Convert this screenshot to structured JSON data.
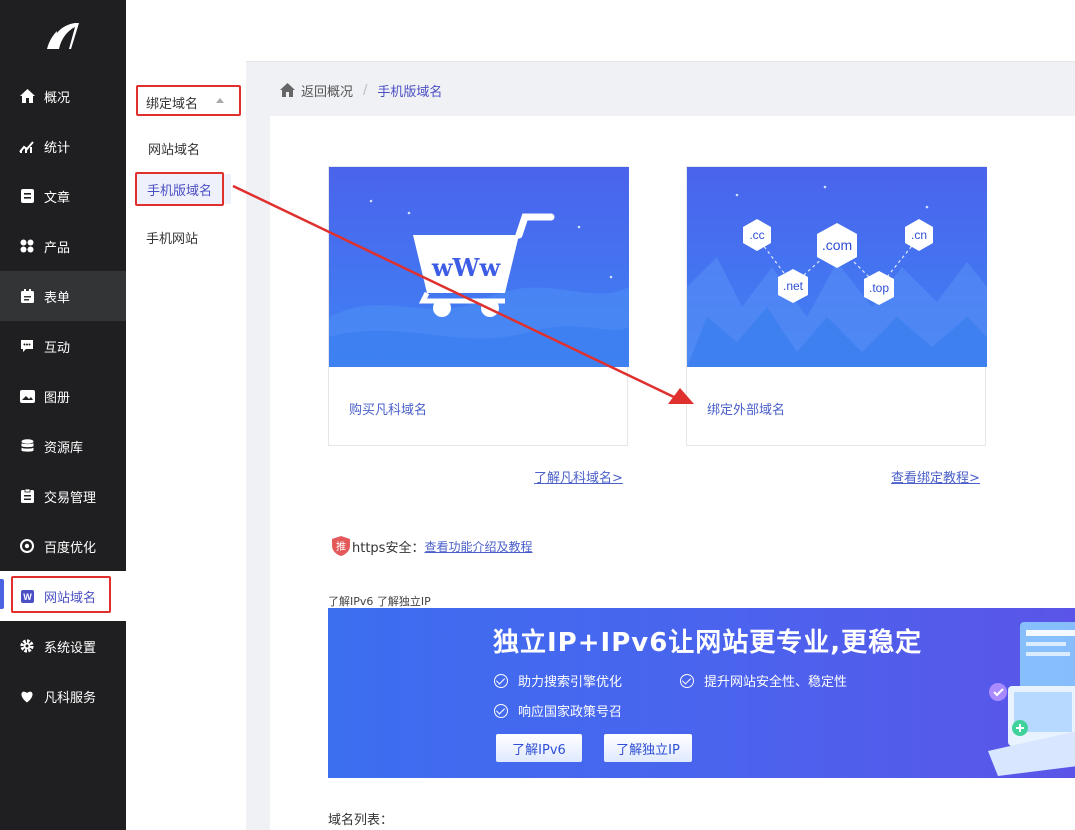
{
  "sidebar": {
    "items": [
      {
        "label": "概况",
        "icon": "home-icon"
      },
      {
        "label": "统计",
        "icon": "chart-icon"
      },
      {
        "label": "文章",
        "icon": "article-icon"
      },
      {
        "label": "产品",
        "icon": "product-icon"
      },
      {
        "label": "表单",
        "icon": "form-icon"
      },
      {
        "label": "互动",
        "icon": "chat-icon"
      },
      {
        "label": "图册",
        "icon": "album-icon"
      },
      {
        "label": "资源库",
        "icon": "database-icon"
      },
      {
        "label": "交易管理",
        "icon": "trade-icon"
      },
      {
        "label": "百度优化",
        "icon": "seo-icon"
      },
      {
        "label": "网站域名",
        "icon": "w-icon"
      },
      {
        "label": "系统设置",
        "icon": "gear-icon"
      },
      {
        "label": "凡科服务",
        "icon": "heart-icon"
      }
    ]
  },
  "subnav": {
    "select_label": "绑定域名",
    "items": [
      "网站域名",
      "手机版域名",
      "手机网站"
    ]
  },
  "breadcrumb": {
    "back": "返回概况",
    "separator": "/",
    "current": "手机版域名"
  },
  "cards": {
    "buy": {
      "label": "购买凡科域名",
      "art": "wWw"
    },
    "bind": {
      "label": "绑定外部域名",
      "tags": [
        ".cc",
        ".com",
        ".cn",
        ".net",
        ".top"
      ]
    }
  },
  "links": {
    "learn_domain": "了解凡科域名>",
    "bind_tutorial": "查看绑定教程>"
  },
  "https": {
    "badge": "推",
    "label": "https安全：",
    "link": "查看功能介绍及教程"
  },
  "ipv6": {
    "title": "了解IPv6 了解独立IP",
    "headline": "独立IP+IPv6让网站更专业,更稳定",
    "features": [
      "助力搜索引擎优化",
      "提升网站安全性、稳定性",
      "响应国家政策号召"
    ],
    "btn_ipv6": "了解IPv6",
    "btn_ip": "了解独立IP"
  },
  "domain_list": {
    "title": "域名列表："
  },
  "colors": {
    "accent": "#4a4fc4",
    "highlight": "#e0302e",
    "sidebar_bg": "#1f1f21"
  }
}
